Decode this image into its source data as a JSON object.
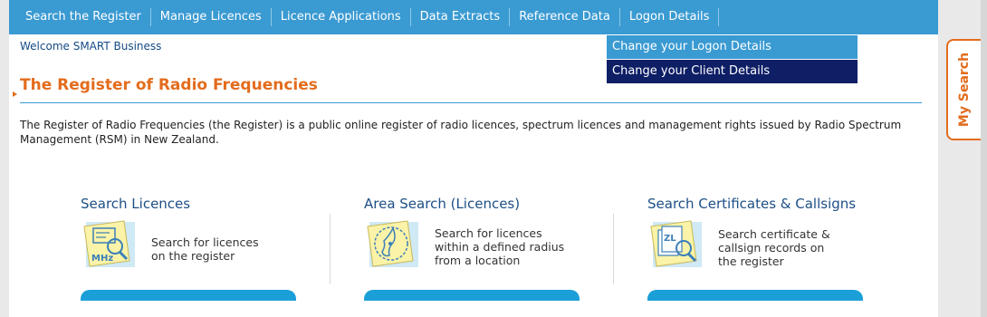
{
  "nav": {
    "items": [
      "Search the Register",
      "Manage Licences",
      "Licence Applications",
      "Data Extracts",
      "Reference Data",
      "Logon Details"
    ]
  },
  "welcome": "Welcome SMART Business",
  "dropdown": {
    "items": [
      "Change your Logon Details",
      "Change your Client Details"
    ]
  },
  "page_title": "The Register of Radio Frequencies",
  "intro": "The Register of Radio Frequencies (the Register) is a public online register of radio licences, spectrum licences and management rights issued by Radio Spectrum Management (RSM) in New Zealand.",
  "cards": [
    {
      "title": "Search Licences",
      "desc_lines": [
        "Search for licences",
        "on the register"
      ],
      "icon": "licence-search-icon",
      "icon_text": "MHz"
    },
    {
      "title": "Area Search (Licences)",
      "desc_lines": [
        "Search for licences",
        "within a defined radius",
        "from a location"
      ],
      "icon": "area-search-map-icon"
    },
    {
      "title": "Search Certificates & Callsigns",
      "desc_lines": [
        "Search certificate &",
        "callsign records on",
        "the register"
      ],
      "icon": "certificate-search-icon",
      "icon_text": "ZL"
    }
  ],
  "my_search": "My Search",
  "colors": {
    "nav": "#3a9ad2",
    "title": "#e36c1d",
    "dropdown_active": "#0e1f66",
    "card_bar": "#1b9fd8"
  }
}
